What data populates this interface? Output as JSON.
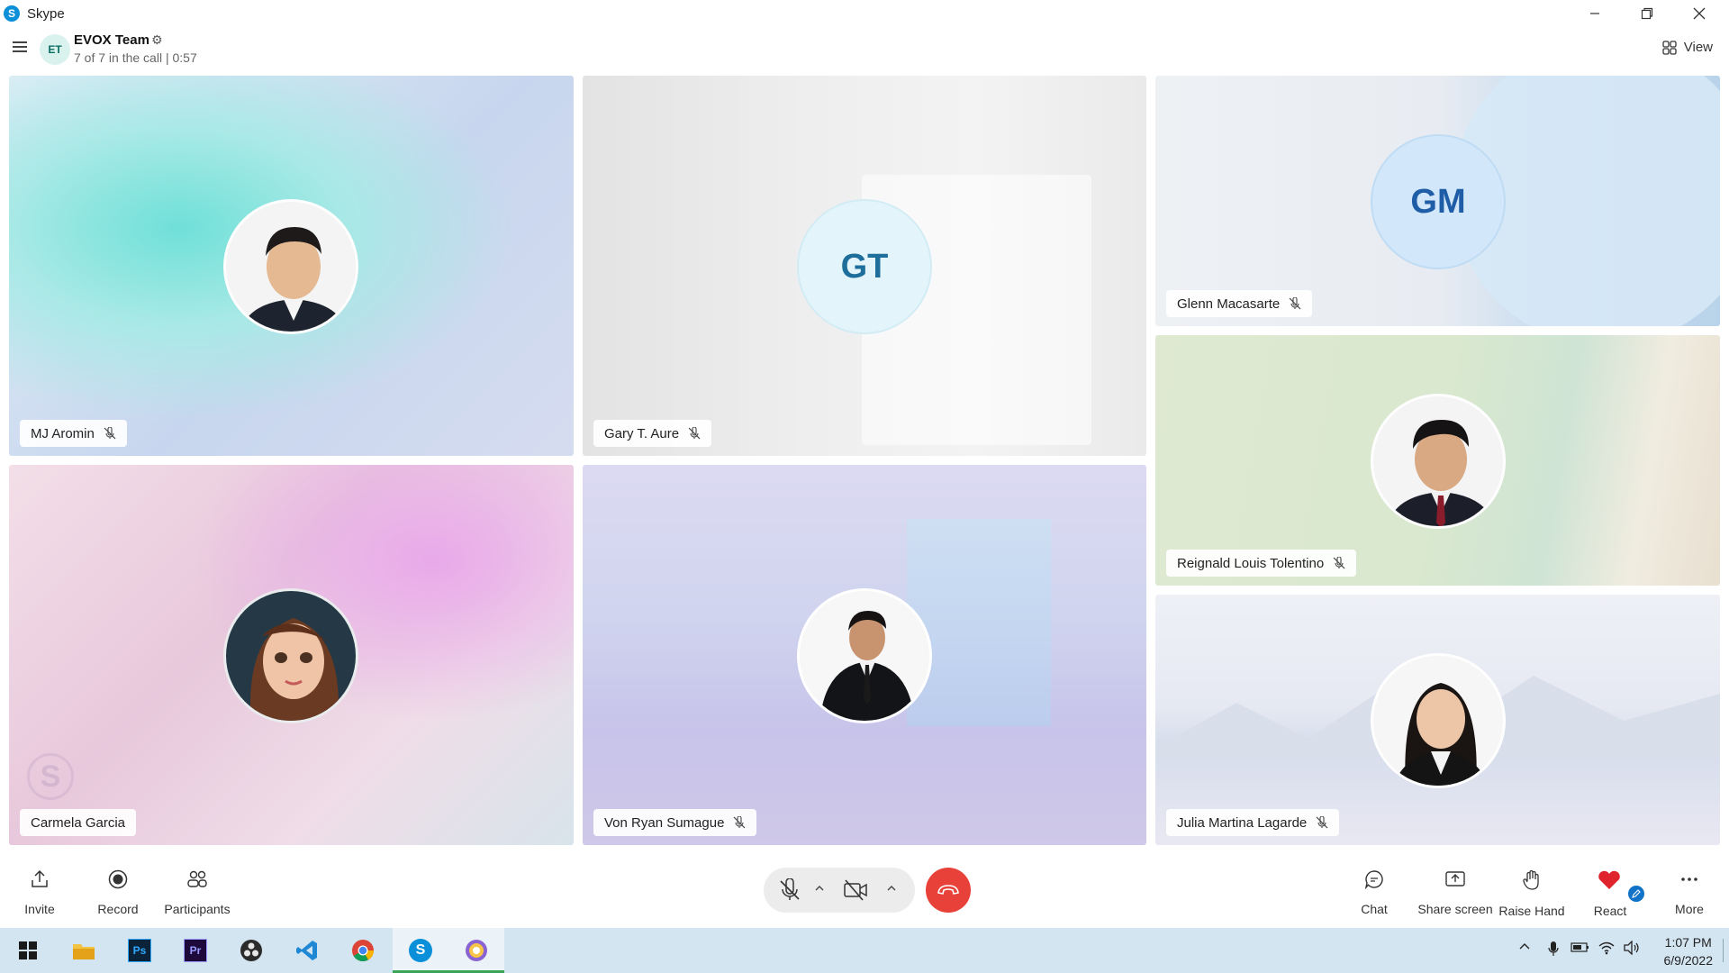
{
  "window": {
    "app_name": "Skype",
    "logo_letter": "S"
  },
  "header": {
    "team_initials": "ET",
    "team_name": "EVOX Team",
    "call_status": "7 of 7 in the call | 0:57",
    "view_label": "View"
  },
  "participants": [
    {
      "name": "MJ Aromin",
      "muted": true,
      "initials": ""
    },
    {
      "name": "Gary T. Aure",
      "muted": true,
      "initials": "GT"
    },
    {
      "name": "Glenn Macasarte",
      "muted": true,
      "initials": "GM"
    },
    {
      "name": "Reignald Louis Tolentino",
      "muted": true,
      "initials": ""
    },
    {
      "name": "Carmela Garcia",
      "muted": false,
      "initials": ""
    },
    {
      "name": "Von Ryan Sumague",
      "muted": true,
      "initials": ""
    },
    {
      "name": "Julia Martina Lagarde",
      "muted": true,
      "initials": ""
    }
  ],
  "toolbar": {
    "invite": "Invite",
    "record": "Record",
    "participants": "Participants",
    "chat": "Chat",
    "share_screen": "Share screen",
    "raise_hand": "Raise Hand",
    "react": "React",
    "more": "More"
  },
  "taskbar": {
    "time": "1:07 PM",
    "date": "6/9/2022"
  },
  "colors": {
    "end_call": "#e8413a",
    "react_heart": "#e0242d",
    "accent": "#0a8fd8",
    "taskbar": "#d3e5f1"
  }
}
